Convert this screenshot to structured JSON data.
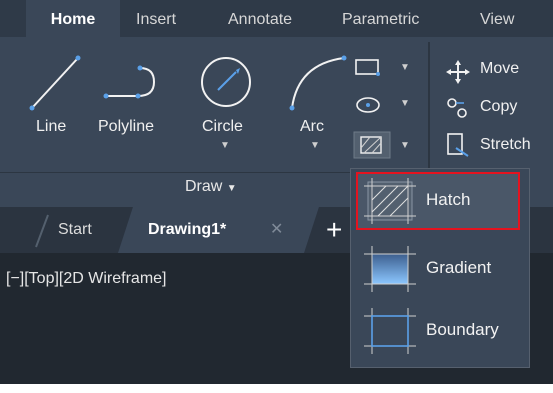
{
  "ribbon_tabs": [
    "Home",
    "Insert",
    "Annotate",
    "Parametric",
    "View"
  ],
  "active_tab": "Home",
  "draw_tools": {
    "line_label": "Line",
    "polyline_label": "Polyline",
    "circle_label": "Circle",
    "arc_label": "Arc"
  },
  "modify_tools": {
    "move_label": "Move",
    "copy_label": "Copy",
    "stretch_label": "Stretch"
  },
  "panel": {
    "title": "Draw"
  },
  "document_tabs": {
    "start_label": "Start",
    "drawing_label": "Drawing1*"
  },
  "viewport": {
    "controls_label": "[−][Top][2D Wireframe]"
  },
  "hatch_menu": {
    "items": [
      {
        "label": "Hatch",
        "selected": true
      },
      {
        "label": "Gradient",
        "selected": false
      },
      {
        "label": "Boundary",
        "selected": false
      }
    ]
  },
  "colors": {
    "ribbon_bg": "#3a4758",
    "tabbar_bg": "#2f3a48",
    "viewport_bg": "#212830",
    "highlight_border": "#e5131f",
    "accent_blue": "#4f8fd6"
  },
  "icons": [
    "line-icon",
    "polyline-icon",
    "circle-icon",
    "arc-icon",
    "rectangle-icon",
    "ellipse-icon",
    "hatch-icon",
    "move-icon",
    "copy-icon",
    "stretch-icon",
    "close-icon",
    "plus-icon",
    "gradient-icon",
    "boundary-icon",
    "chevron-down-icon"
  ]
}
